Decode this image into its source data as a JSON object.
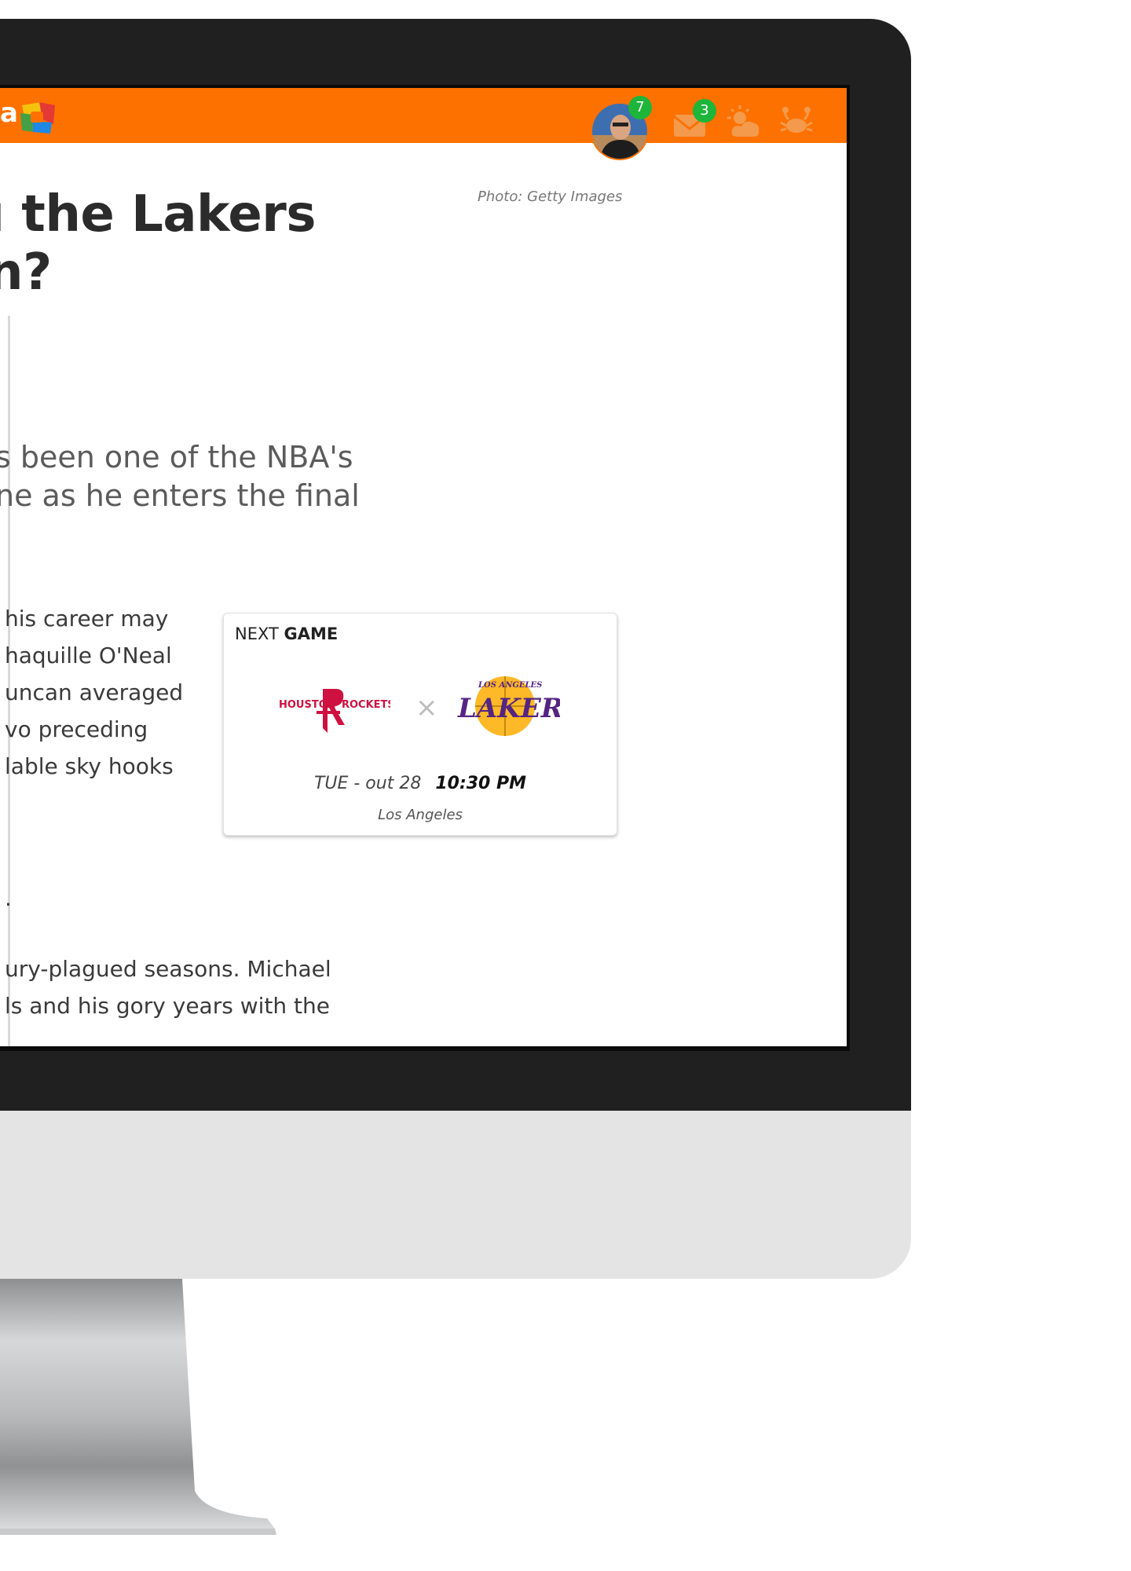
{
  "header": {
    "logo_letter": "a",
    "avatar_badge": "7",
    "mail_badge": "3",
    "icons": [
      "avatar",
      "mail-icon",
      "weather-icon",
      "crab-icon"
    ],
    "accent_color": "#fd7100",
    "badge_color": "#1db53a"
  },
  "article": {
    "headline_line1": "ı the Lakers",
    "headline_line2": "n?",
    "photo_credit": "Photo: Getty Images",
    "lead_line1": "s been one of the NBA's",
    "lead_line2": "ne as he enters the final",
    "body_lines": [
      "his career may",
      "haquille O'Neal",
      "uncan averaged",
      "vo preceding",
      "lable sky hooks"
    ],
    "stray_period": ".",
    "body_lines_2": [
      "ury-plagued seasons. Michael",
      "ls and his gory years with the"
    ]
  },
  "next_game": {
    "title_prefix": "NEXT",
    "title_bold": "GAME",
    "home_team": "HOUSTON ROCKETS",
    "away_team": "LOS ANGELES LAKERS",
    "versus_symbol": "×",
    "date": "TUE -  out 28",
    "time": "10:30 PM",
    "location": "Los Angeles"
  }
}
